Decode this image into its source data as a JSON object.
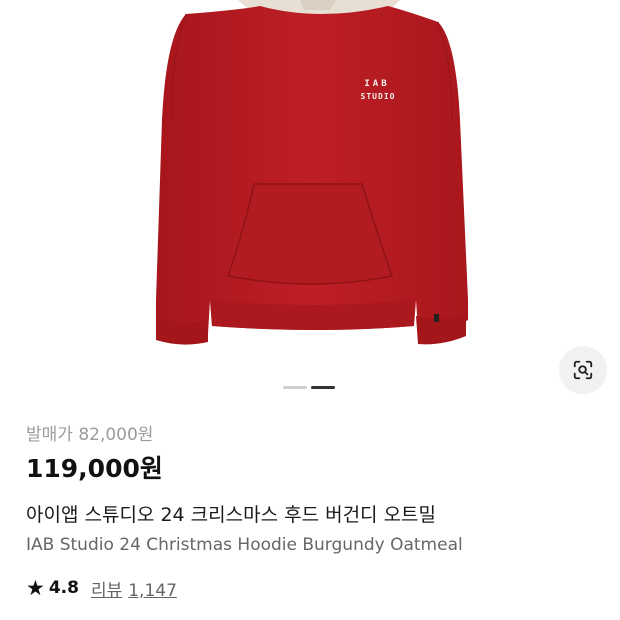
{
  "gallery": {
    "product_alt": "IAB Studio 24 Christmas Hoodie Burgundy Oatmeal",
    "chest_print_line1": "IAB",
    "chest_print_line2": "STUDIO",
    "page_count": 2,
    "active_page": 2
  },
  "lens_button": {
    "icon": "image-search-icon"
  },
  "price": {
    "list_label": "발매가",
    "list_value": "82,000원",
    "sale_value": "119,000원"
  },
  "product": {
    "title_ko": "아이앱 스튜디오 24 크리스마스 후드 버건디 오트밀",
    "title_en": "IAB Studio 24 Christmas Hoodie Burgundy Oatmeal"
  },
  "rating": {
    "icon": "star-icon",
    "value": "4.8",
    "review_label": "리뷰",
    "review_count": "1,147"
  },
  "colors": {
    "hoodie": "#b81d22",
    "hood": "#e7dfd4",
    "text_primary": "#111111",
    "text_muted": "#9b9b9b"
  }
}
